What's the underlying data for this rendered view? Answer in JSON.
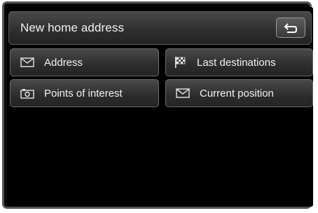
{
  "header": {
    "title": "New home address",
    "back_icon": "back-arrow-icon"
  },
  "menu": {
    "items": [
      {
        "label": "Address",
        "icon": "envelope-icon"
      },
      {
        "label": "Last destinations",
        "icon": "checkered-flag-icon"
      },
      {
        "label": "Points of interest",
        "icon": "camera-icon"
      },
      {
        "label": "Current position",
        "icon": "envelope-icon"
      }
    ]
  },
  "colors": {
    "screen_background": "#000000",
    "button_text": "#f2f2f2",
    "button_border": "#6a6a6a",
    "frame": "#555555"
  }
}
